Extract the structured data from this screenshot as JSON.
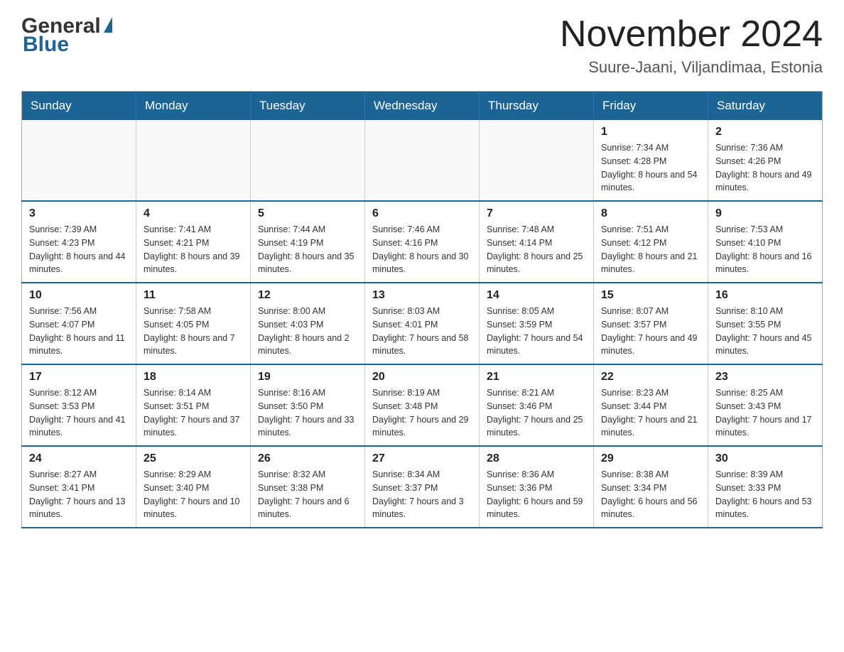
{
  "logo": {
    "text_general": "General",
    "text_blue": "Blue"
  },
  "title": "November 2024",
  "subtitle": "Suure-Jaani, Viljandimaa, Estonia",
  "weekdays": [
    "Sunday",
    "Monday",
    "Tuesday",
    "Wednesday",
    "Thursday",
    "Friday",
    "Saturday"
  ],
  "weeks": [
    [
      {
        "day": "",
        "info": ""
      },
      {
        "day": "",
        "info": ""
      },
      {
        "day": "",
        "info": ""
      },
      {
        "day": "",
        "info": ""
      },
      {
        "day": "",
        "info": ""
      },
      {
        "day": "1",
        "info": "Sunrise: 7:34 AM\nSunset: 4:28 PM\nDaylight: 8 hours and 54 minutes."
      },
      {
        "day": "2",
        "info": "Sunrise: 7:36 AM\nSunset: 4:26 PM\nDaylight: 8 hours and 49 minutes."
      }
    ],
    [
      {
        "day": "3",
        "info": "Sunrise: 7:39 AM\nSunset: 4:23 PM\nDaylight: 8 hours and 44 minutes."
      },
      {
        "day": "4",
        "info": "Sunrise: 7:41 AM\nSunset: 4:21 PM\nDaylight: 8 hours and 39 minutes."
      },
      {
        "day": "5",
        "info": "Sunrise: 7:44 AM\nSunset: 4:19 PM\nDaylight: 8 hours and 35 minutes."
      },
      {
        "day": "6",
        "info": "Sunrise: 7:46 AM\nSunset: 4:16 PM\nDaylight: 8 hours and 30 minutes."
      },
      {
        "day": "7",
        "info": "Sunrise: 7:48 AM\nSunset: 4:14 PM\nDaylight: 8 hours and 25 minutes."
      },
      {
        "day": "8",
        "info": "Sunrise: 7:51 AM\nSunset: 4:12 PM\nDaylight: 8 hours and 21 minutes."
      },
      {
        "day": "9",
        "info": "Sunrise: 7:53 AM\nSunset: 4:10 PM\nDaylight: 8 hours and 16 minutes."
      }
    ],
    [
      {
        "day": "10",
        "info": "Sunrise: 7:56 AM\nSunset: 4:07 PM\nDaylight: 8 hours and 11 minutes."
      },
      {
        "day": "11",
        "info": "Sunrise: 7:58 AM\nSunset: 4:05 PM\nDaylight: 8 hours and 7 minutes."
      },
      {
        "day": "12",
        "info": "Sunrise: 8:00 AM\nSunset: 4:03 PM\nDaylight: 8 hours and 2 minutes."
      },
      {
        "day": "13",
        "info": "Sunrise: 8:03 AM\nSunset: 4:01 PM\nDaylight: 7 hours and 58 minutes."
      },
      {
        "day": "14",
        "info": "Sunrise: 8:05 AM\nSunset: 3:59 PM\nDaylight: 7 hours and 54 minutes."
      },
      {
        "day": "15",
        "info": "Sunrise: 8:07 AM\nSunset: 3:57 PM\nDaylight: 7 hours and 49 minutes."
      },
      {
        "day": "16",
        "info": "Sunrise: 8:10 AM\nSunset: 3:55 PM\nDaylight: 7 hours and 45 minutes."
      }
    ],
    [
      {
        "day": "17",
        "info": "Sunrise: 8:12 AM\nSunset: 3:53 PM\nDaylight: 7 hours and 41 minutes."
      },
      {
        "day": "18",
        "info": "Sunrise: 8:14 AM\nSunset: 3:51 PM\nDaylight: 7 hours and 37 minutes."
      },
      {
        "day": "19",
        "info": "Sunrise: 8:16 AM\nSunset: 3:50 PM\nDaylight: 7 hours and 33 minutes."
      },
      {
        "day": "20",
        "info": "Sunrise: 8:19 AM\nSunset: 3:48 PM\nDaylight: 7 hours and 29 minutes."
      },
      {
        "day": "21",
        "info": "Sunrise: 8:21 AM\nSunset: 3:46 PM\nDaylight: 7 hours and 25 minutes."
      },
      {
        "day": "22",
        "info": "Sunrise: 8:23 AM\nSunset: 3:44 PM\nDaylight: 7 hours and 21 minutes."
      },
      {
        "day": "23",
        "info": "Sunrise: 8:25 AM\nSunset: 3:43 PM\nDaylight: 7 hours and 17 minutes."
      }
    ],
    [
      {
        "day": "24",
        "info": "Sunrise: 8:27 AM\nSunset: 3:41 PM\nDaylight: 7 hours and 13 minutes."
      },
      {
        "day": "25",
        "info": "Sunrise: 8:29 AM\nSunset: 3:40 PM\nDaylight: 7 hours and 10 minutes."
      },
      {
        "day": "26",
        "info": "Sunrise: 8:32 AM\nSunset: 3:38 PM\nDaylight: 7 hours and 6 minutes."
      },
      {
        "day": "27",
        "info": "Sunrise: 8:34 AM\nSunset: 3:37 PM\nDaylight: 7 hours and 3 minutes."
      },
      {
        "day": "28",
        "info": "Sunrise: 8:36 AM\nSunset: 3:36 PM\nDaylight: 6 hours and 59 minutes."
      },
      {
        "day": "29",
        "info": "Sunrise: 8:38 AM\nSunset: 3:34 PM\nDaylight: 6 hours and 56 minutes."
      },
      {
        "day": "30",
        "info": "Sunrise: 8:39 AM\nSunset: 3:33 PM\nDaylight: 6 hours and 53 minutes."
      }
    ]
  ]
}
